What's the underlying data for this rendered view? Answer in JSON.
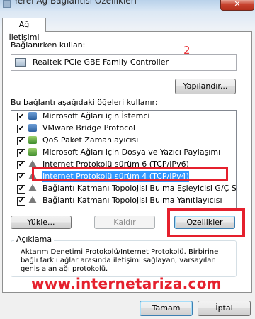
{
  "window": {
    "title": "Yerel Ağ Bağlantısı Özellikleri",
    "close_label": "✕"
  },
  "tabs": [
    {
      "label": "Ağ İletişimi",
      "active": true
    }
  ],
  "connect_using": {
    "label": "Bağlanırken kullan:",
    "adapter_name": "Realtek PCIe GBE Family Controller",
    "configure_label": "Yapılandır..."
  },
  "annotation": {
    "step_number": "2",
    "watermark": "www.internetariza.com",
    "color": "#e5202d"
  },
  "items": {
    "label": "Bu bağlantı aşağıdaki öğeleri kullanır:",
    "list": [
      {
        "label": "Microsoft Ağları için İstemci",
        "checked": true,
        "icon": "network-client-icon"
      },
      {
        "label": "VMware Bridge Protocol",
        "checked": true,
        "icon": "network-protocol-icon"
      },
      {
        "label": "QoS Paket Zamanlayıcısı",
        "checked": true,
        "icon": "network-service-icon"
      },
      {
        "label": "Microsoft Ağları için Dosya ve Yazıcı Paylaşımı",
        "checked": true,
        "icon": "network-service-icon"
      },
      {
        "label": "Internet Protokolü sürüm 6 (TCP/IPv6)",
        "checked": true,
        "icon": "network-protocol-icon"
      },
      {
        "label": "Internet Protokolü sürüm 4 (TCP/IPv4)",
        "checked": true,
        "icon": "network-protocol-icon",
        "selected": true
      },
      {
        "label": "Bağlantı Katmanı Topolojisi Bulma Eşleyicisi G/Ç Sürücü...",
        "checked": true,
        "icon": "network-protocol-icon"
      },
      {
        "label": "Bağlantı Katmanı Topolojisi Bulma Yanıtlayıcısı",
        "checked": true,
        "icon": "network-protocol-icon"
      }
    ],
    "check_mark": "✔"
  },
  "actions": {
    "install_label": "Yükle...",
    "uninstall_label": "Kaldır",
    "properties_label": "Özellikler"
  },
  "description": {
    "title": "Açıklama",
    "text": "Aktarım Denetimi Protokolü/Internet Protokolü. Birbirine bağlı farklı ağlar arasında iletişimi sağlayan, varsayılan geniş alan ağı protokolü."
  },
  "footer": {
    "ok_label": "Tamam",
    "cancel_label": "İptal"
  }
}
